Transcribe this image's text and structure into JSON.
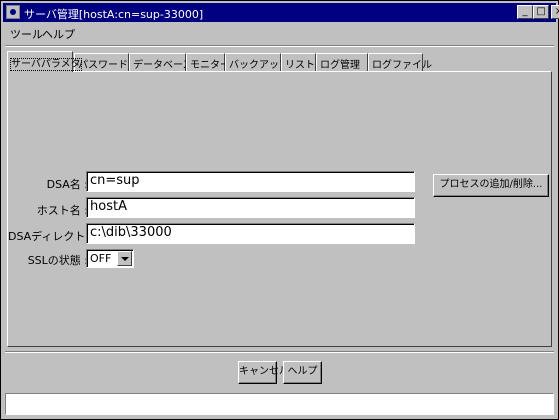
{
  "window": {
    "title": "サーバ管理[hostA:cn=sup-33000]",
    "controls": {
      "minimize": "_",
      "maximize": "□",
      "close": "×"
    }
  },
  "menubar": {
    "items": [
      {
        "label": "ツール"
      },
      {
        "label": "ヘルプ"
      }
    ]
  },
  "tabs": [
    {
      "label": "サーバパラメタ",
      "active": true
    },
    {
      "label": "パスワード",
      "active": false
    },
    {
      "label": "データベース",
      "active": false
    },
    {
      "label": "モニター",
      "active": false
    },
    {
      "label": "バックアップ",
      "active": false
    },
    {
      "label": "リストア",
      "active": false
    },
    {
      "label": "ログ管理",
      "active": false
    },
    {
      "label": "ログファイル",
      "active": false
    }
  ],
  "form": {
    "dsa_name": {
      "label": "DSA名 :",
      "value": "cn=sup"
    },
    "host_name": {
      "label": "ホスト名 :",
      "value": "hostA"
    },
    "dsa_directory": {
      "label": "DSAディレクトリ :",
      "value": "c:\\dib\\33000"
    },
    "ssl_state": {
      "label": "SSLの状態 :",
      "value": "OFF"
    }
  },
  "process_button": {
    "label": "プロセスの追加/削除..."
  },
  "footer": {
    "cancel_label": "キャンセル",
    "help_label": "ヘルプ"
  },
  "status": {
    "text": ""
  }
}
